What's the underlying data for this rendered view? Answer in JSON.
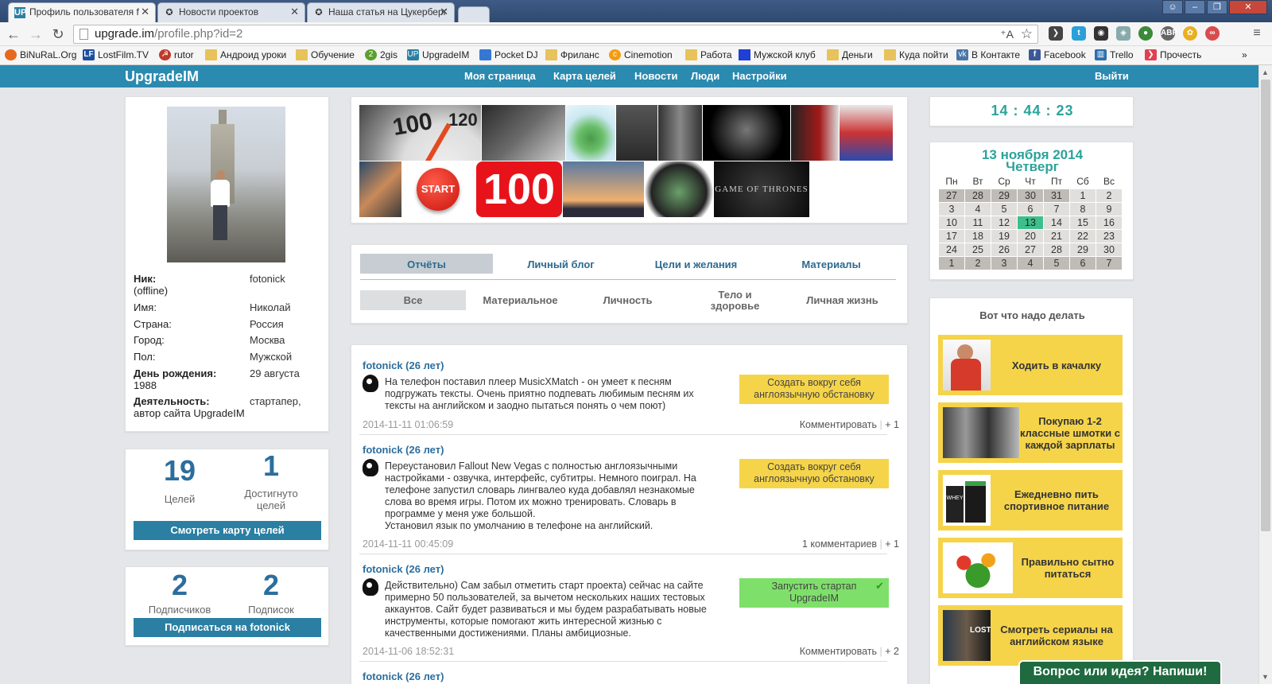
{
  "browser": {
    "tabs": [
      {
        "title": "Профиль пользователя f",
        "active": true,
        "icon": "upgradeim-favicon"
      },
      {
        "title": "Новости проектов",
        "active": false,
        "icon": "star-icon"
      },
      {
        "title": "Наша статья на Цукерберг",
        "active": false,
        "icon": "star-icon"
      }
    ],
    "url_host": "upgrade.im",
    "url_path": "/profile.php?id=2",
    "translate_icon": "⁺A",
    "bookmarks": [
      {
        "label": "BiNuRaL.Org",
        "icon": "firefox-icon",
        "color": "#e66a1e"
      },
      {
        "label": "LostFilm.TV",
        "icon": "lf-icon",
        "color": "#1b4ea0"
      },
      {
        "label": "rutor",
        "icon": "rutor-icon",
        "color": "#c0392b"
      },
      {
        "label": "Андроид уроки",
        "icon": "folder-icon",
        "color": "#e8c25a"
      },
      {
        "label": "Обучение",
        "icon": "folder-icon",
        "color": "#e8c25a"
      },
      {
        "label": "2gis",
        "icon": "2gis-icon",
        "color": "#5aa02c"
      },
      {
        "label": "UpgradeIM",
        "icon": "upgradeim-icon",
        "color": "#2a7fa3"
      },
      {
        "label": "Pocket DJ",
        "icon": "pocketdj-icon",
        "color": "#3478d4"
      },
      {
        "label": "Фриланс",
        "icon": "folder-icon",
        "color": "#e8c25a"
      },
      {
        "label": "Cinemotion",
        "icon": "cinemotion-icon",
        "color": "#f39c12"
      },
      {
        "label": "Работа",
        "icon": "folder-icon",
        "color": "#e8c25a"
      },
      {
        "label": "Мужской клуб",
        "icon": "square-icon",
        "color": "#1f3fd6"
      },
      {
        "label": "Деньги",
        "icon": "folder-icon",
        "color": "#e8c25a"
      },
      {
        "label": "Куда пойти",
        "icon": "folder-icon",
        "color": "#e8c25a"
      },
      {
        "label": "В Контакте",
        "icon": "vk-icon",
        "color": "#4a76a8"
      },
      {
        "label": "Facebook",
        "icon": "facebook-icon",
        "color": "#3b5998"
      },
      {
        "label": "Trello",
        "icon": "trello-icon",
        "color": "#2a6fb0"
      },
      {
        "label": "Прочесть",
        "icon": "pocket-icon",
        "color": "#e04152"
      }
    ],
    "bookmarks_more": "»"
  },
  "site": {
    "logo": "UpgradeIM",
    "nav": [
      "Моя страница",
      "Карта целей",
      "Новости",
      "Люди",
      "Настройки"
    ],
    "logout": "Выйти"
  },
  "profile": {
    "nick_label": "Ник:",
    "status": "(offline)",
    "nick": "fotonick",
    "fields": [
      {
        "label": "Имя:",
        "value": "Николай"
      },
      {
        "label": "Страна:",
        "value": "Россия"
      },
      {
        "label": "Город:",
        "value": "Москва"
      },
      {
        "label": "Пол:",
        "value": "Мужской"
      }
    ],
    "birthday_label": "День рождения:",
    "birthday_value": "29 августа",
    "birthday_year": "1988",
    "activity_label": "Деятельность:",
    "activity_value": "стартапер,",
    "activity_value2": "автор сайта UpgradeIM"
  },
  "goals_stats": {
    "goals_count": "19",
    "goals_label": "Целей",
    "achieved_count": "1",
    "achieved_label_1": "Достигнуто",
    "achieved_label_2": "целей",
    "button": "Смотреть карту целей"
  },
  "subs_stats": {
    "subscribers_count": "2",
    "subscribers_label": "Подписчиков",
    "subscriptions_count": "2",
    "subscriptions_label": "Подписок",
    "button": "Подписаться на fotonick"
  },
  "mosaic": {
    "start_label": "START",
    "hundred_label": "100",
    "got_label": "GAME OF THRONES",
    "speedo_100": "100",
    "speedo_120": "120"
  },
  "main_tabs": [
    "Отчёты",
    "Личный блог",
    "Цели и желания",
    "Материалы"
  ],
  "sub_tabs": [
    {
      "label": "Все"
    },
    {
      "label": "Материальное"
    },
    {
      "label": "Личность"
    },
    {
      "label": "Тело и",
      "label2": "здоровье"
    },
    {
      "label": "Личная жизнь"
    }
  ],
  "posts": [
    {
      "author": "fotonick (26 лет)",
      "lines": [
        "На телефон поставил плеер MusicXMatch - он умеет к песням",
        "подгружать тексты. Очень приятно подпевать любимым песням их",
        "тексты на английском и заодно пытаться понять о чем поют)"
      ],
      "goal_1": "Создать вокруг себя",
      "goal_2": "англоязычную обстановку",
      "date": "2014-11-11 01:06:59",
      "comments": "Комментировать",
      "plus": "+ 1"
    },
    {
      "author": "fotonick (26 лет)",
      "lines": [
        "Переустановил Fallout New Vegas с полностью англоязычными",
        "настройками - озвучка, интерфейс, субтитры. Немного поиграл. На",
        "телефоне запустил словарь лингвалео куда добавлял незнакомые",
        "слова во время игры. Потом их можно тренировать. Словарь в",
        "программе у меня уже большой.",
        "Установил язык по умолчанию в телефоне на английский."
      ],
      "goal_1": "Создать вокруг себя",
      "goal_2": "англоязычную обстановку",
      "date": "2014-11-11 00:45:09",
      "comments": "1 комментариев",
      "plus": "+ 1"
    },
    {
      "author": "fotonick (26 лет)",
      "lines": [
        "Действительно) Сам забыл отметить старт проекта) сейчас на сайте",
        "примерно 50 пользователей, за вычетом нескольких наших тестовых",
        "аккаунтов. Сайт будет развиваться и мы будем разрабатывать новые",
        "инструменты, которые помогают жить интересной жизнью с",
        "качественными достижениями. Планы амбициозные."
      ],
      "goal_1": "Запустить стартап",
      "goal_2": "UpgradeIM",
      "date": "2014-11-06 18:52:31",
      "comments": "Комментировать",
      "plus": "+ 2"
    },
    {
      "author": "fotonick (26 лет)"
    }
  ],
  "clock": "14 : 44 : 23",
  "calendar": {
    "date_line": "13 ноября 2014",
    "weekday": "Четверг",
    "headers": [
      "Пн",
      "Вт",
      "Ср",
      "Чт",
      "Пт",
      "Сб",
      "Вс"
    ],
    "days": [
      "27",
      "28",
      "29",
      "30",
      "31",
      "1",
      "2",
      "3",
      "4",
      "5",
      "6",
      "7",
      "8",
      "9",
      "10",
      "11",
      "12",
      "13",
      "14",
      "15",
      "16",
      "17",
      "18",
      "19",
      "20",
      "21",
      "22",
      "23",
      "24",
      "25",
      "26",
      "27",
      "28",
      "29",
      "30",
      "1",
      "2",
      "3",
      "4",
      "5",
      "6",
      "7"
    ],
    "today_index": 17,
    "today_color": "#3cbf8a"
  },
  "todo": {
    "title": "Вот что надо делать",
    "items": [
      {
        "label": "Ходить в качалку"
      },
      {
        "label": "Покупаю 1-2 классные шмотки с каждой зарплаты"
      },
      {
        "label": "Ежедневно пить спортивное питание"
      },
      {
        "label": "Правильно сытно питаться"
      },
      {
        "label": "Смотреть сериалы на английском языке"
      }
    ],
    "whey_label": "WHEY",
    "lost_label": "LOST"
  },
  "feedback": "Вопрос или идея? Напиши!",
  "colors": {
    "accent": "#2a8ab0",
    "title_blue": "#2b6e9e",
    "teal": "#2ba39b",
    "goal_yellow": "#f5d44a",
    "goal_green": "#7ee06a"
  }
}
